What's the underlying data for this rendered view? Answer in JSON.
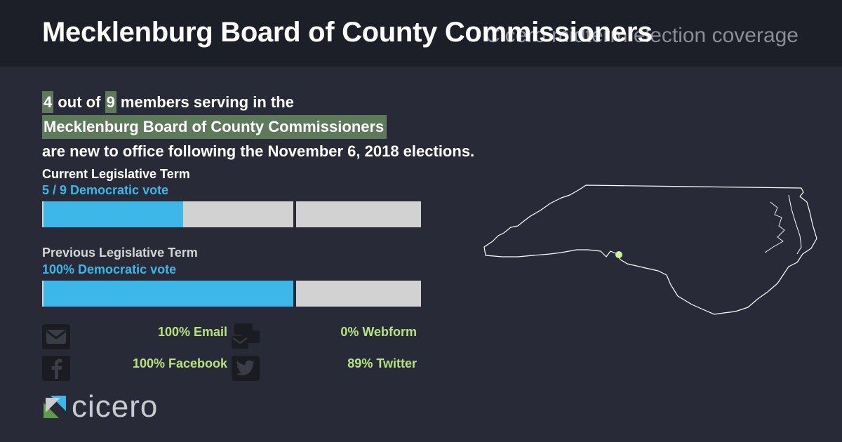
{
  "header": {
    "title": "Mecklenburg Board of County Commissioners",
    "subtitle": "Cicero midterm election coverage"
  },
  "summary": {
    "new_count": "4",
    "text_out_of": " out of ",
    "total": "9",
    "text_members": " members serving in the",
    "body_name": "Mecklenburg Board of County Commissioners",
    "text_line3": "are new to office following the November 6, 2018 elections."
  },
  "current_term": {
    "label": "Current Legislative Term",
    "vote_text": "5 / 9 Democratic vote",
    "democratic_share": 0.556
  },
  "previous_term": {
    "label": "Previous Legislative Term",
    "vote_text": "100% Democratic vote",
    "democratic_share": 1.0
  },
  "contacts": [
    {
      "icon": "email-icon",
      "text": "100% Email"
    },
    {
      "icon": "webform-icon",
      "text": "0% Webform"
    },
    {
      "icon": "facebook-icon",
      "text": "100% Facebook"
    },
    {
      "icon": "twitter-icon",
      "text": "89% Twitter"
    }
  ],
  "logo": {
    "text": "cicero"
  },
  "colors": {
    "background": "#282b37",
    "header": "#1d1f28",
    "highlight": "#5f7a5b",
    "democratic": "#3db7e8",
    "stat_green": "#b6e37f",
    "map_marker": "#c8f59a"
  }
}
